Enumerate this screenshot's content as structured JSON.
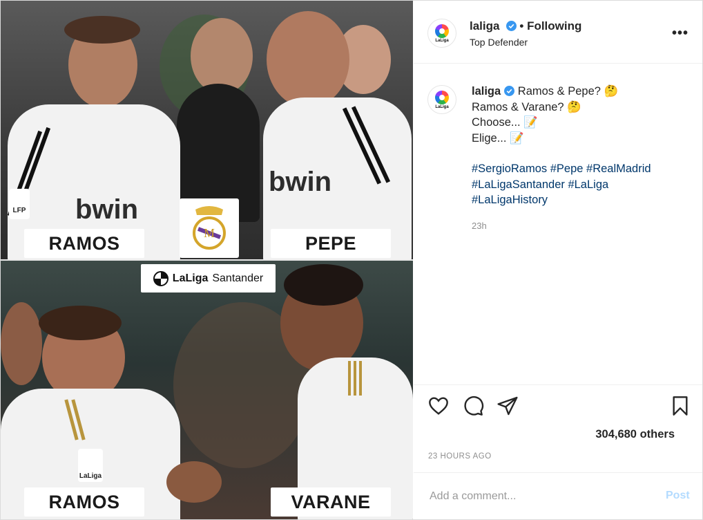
{
  "post": {
    "media": {
      "top_left_name": "RAMOS",
      "top_right_name": "PEPE",
      "bottom_left_name": "RAMOS",
      "bottom_right_name": "VARANE",
      "banner_text_a": "LaLiga",
      "banner_text_b": "Santander",
      "badge_top": "LFP",
      "badge_bottom": "LaLiga",
      "jersey_sponsor": "bwin"
    },
    "header": {
      "username": "laliga",
      "follow_status": "Following",
      "location": "Top Defender",
      "avatar_label": "LaLiga",
      "more_icon": "more-options-icon"
    },
    "caption": {
      "username": "laliga",
      "line1": "Ramos & Pepe? 🤔",
      "line2": "Ramos & Varane? 🤔",
      "line3": "Choose... 📝",
      "line4": "Elige... 📝",
      "hashtag_line1": "#SergioRamos #Pepe #RealMadrid",
      "hashtag_line2": "#LaLigaSantander #LaLiga",
      "hashtag_line3": "#LaLigaHistory",
      "time_ago": "23h"
    },
    "actions": {
      "icons": [
        "heart-icon",
        "comment-icon",
        "share-icon",
        "bookmark-icon"
      ],
      "likes": "304,680 others",
      "timestamp": "23 HOURS AGO"
    },
    "comment": {
      "placeholder": "Add a comment...",
      "post_label": "Post"
    },
    "colors": {
      "hashtag": "#00376b",
      "verified": "#3897f0",
      "post_disabled": "#b3dbff"
    }
  }
}
